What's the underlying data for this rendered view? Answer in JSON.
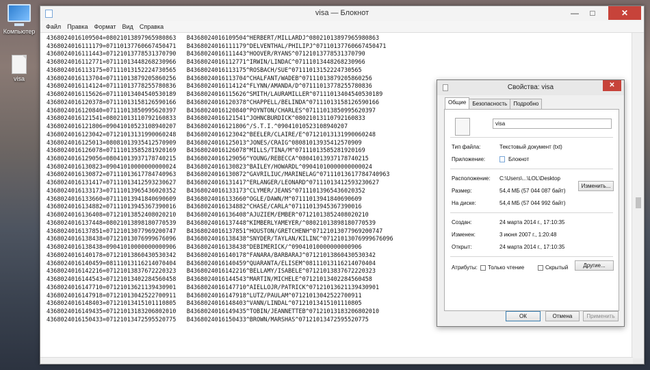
{
  "desktop": {
    "icons": [
      {
        "label": "Компьютер"
      },
      {
        "label": "visa"
      }
    ]
  },
  "notepad": {
    "title": "visa — Блокнот",
    "menu": [
      "Файл",
      "Правка",
      "Формат",
      "Вид",
      "Справка"
    ],
    "lines": [
      "4368024016109504=08021013897965980863   B4368024016109504^HERBERT/MILLARDJ^08021013897965980863",
      "4368024016111179=07110137760667450471   B4368024016111179^DELVENTHAL/PHILIPJ^07110137760667450471",
      "4368024016111443=07121013778531370790   B4368024016111443^HOOVER/RYANS^07121013778531370790",
      "4368024016112771=07111013448268230966   B4368024016112771^IRWIN/LINDAC^07111013448268230966",
      "4368024016113175=07111013152224730565   B4368024016113175^ROSBACH/SUE^07111013152224730565",
      "4368024016113704=07111013879205860256   B4368024016113704^CHALFANT/WADEB^07111013879205860256",
      "4368024016114124=07111013778255780836   B4368024016114124^FLYNN/AMANDA/D^07111013778255780836",
      "4368024016115626=07111013404540530189   B4368024016115626^SMITH/LAURAMILLER^07111013404540530189",
      "4368024016120378=07111013158126590166   B4368024016120378^CHAPPELL/BELINDA^07111013158126590166",
      "4368024016120840=07111013850995620397   B4368024016120840^POYNTON/CHARLES^07111013850995620397",
      "4368024016121541=08021013110792160833   B4368024016121541^JOHNCBURDICK^08021013110792160833",
      "4368024016121806=09041010523108940207   B4368024016121806^/S.T.I.^09041010523108940207",
      "4368024016123042=07121013131990060248   B4368024016123042^BEELER/CLAIRE/E^07121013131990060248",
      "4368024016125013=08081013935412570909   B4368024016125013^JONES/CRAIG^08081013935412570909",
      "4368024016126078=07111013585281920169   B4368024016126078^MILLS/TINA/M^07111013585281920169",
      "4368024016129056=08041013937178740215   B4368024016129056^YOUNG/REBECCA^08041013937178740215",
      "4368024016130823=09041010000000000024   B4368024016130823^BAILEY/HOWARDL^09041010000000000024",
      "4368024016130872=07111013617784740963   B4368024016130872^GAVRILIUC/MARINELAG^07111013617784740963",
      "4368024016131417=07111013412593230627   B4368024016131417^ERLANGER/LEONARD^07111013412593230627",
      "4368024016133173=07111013965436020352   B4368024016133173^CLYMER/JEANS^07111013965436020352",
      "4368024016133660=07111013941840690609   B4368024016133660^OGLE/DAWN/M^07111013941840690609",
      "4368024016134882=07111013945367390016   B4368024016134882^CHASE/CARLA^07111013945367390016",
      "4368024016136408=07121013852408020210   B4368024016136408^AJUZIEM/EMBER^07121013852408020210",
      "4368024016137448=08021013898180770539   B4368024016137448^KIMBERLYAMEYER/^08021013898180770539",
      "4368024016137851=07121013077969200747   B4368024016137851^HOUSTON/GRETCHENH^07121013077969200747",
      "4368024016138438=07121013076999676096   B4368024016138438^SNYDER/TAYLAN/KILINC^07121013076999676096",
      "4368024016138438=09041010000000000906   B4368024016138438^DEBIMERICK/^09041010000000000906",
      "4368024016140178=07121013860430530342   B4368024016140178^FANARA/BARBARAJ^07121013860430530342",
      "4368024016140459=08111013116214070404   B4368024016140459^QUARANTA/ELISEM^08111013116214070404",
      "4368024016142216=07121013837672220323   B4368024016142216^BELLAMY/ISABELE^07121013837672220323",
      "4368024016144543=07121013402284560458   B4368024016144543^MARTIN/MICHELE^07121013402284560458",
      "4368024016147710=07121013621139430901   B4368024016147710^AIELLOJR/PATRICK^07121013621139430901",
      "4368024016147918=07121013042522700911   B4368024016147918^LUTZ/PAULAM^07121013042522700911",
      "4368024016148403=07121013415101110805   B4368024016148403^VANN/LINDAL^07121013415101110805",
      "4368024016149435=07121013183206802010   B4368024016149435^TOBIN/JEANNETTEB^07121013183206802010",
      "4368024016150433=07121013472595520775   B4368024016150433^BROWN/MARSHAS^07121013472595520775"
    ]
  },
  "properties": {
    "title": "Свойства: visa",
    "tabs": [
      "Общие",
      "Безопасность",
      "Подробно"
    ],
    "file_name": "visa",
    "file_type_label": "Тип файла:",
    "file_type": "Текстовый документ (txt)",
    "app_label": "Приложение:",
    "app": "Блокнот",
    "change_button": "Изменить...",
    "location_label": "Расположение:",
    "location": "C:\\Users\\...\\LOL\\Desktop",
    "size_label": "Размер:",
    "size": "54,4 МБ (57 044 087 байт)",
    "size_on_disk_label": "На диске:",
    "size_on_disk": "54,4 МБ (57 044 992 байт)",
    "created_label": "Создан:",
    "created": "24 марта 2014 г., 17:10:35",
    "modified_label": "Изменен:",
    "modified": "3 июня 2007 г., 1:20:48",
    "opened_label": "Открыт:",
    "opened": "24 марта 2014 г., 17:10:35",
    "attributes_label": "Атрибуты:",
    "readonly_label": "Только чтение",
    "hidden_label": "Скрытый",
    "advanced_button": "Другие...",
    "ok_button": "ОК",
    "cancel_button": "Отмена",
    "apply_button": "Применить"
  }
}
